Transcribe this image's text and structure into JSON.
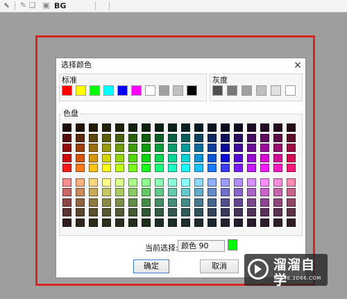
{
  "toolbar": {
    "text": "BG",
    "icons": [
      "arrow-icon",
      "brush-icon",
      "layers-icon",
      "bg-icon"
    ]
  },
  "dialog": {
    "title": "选择颜色",
    "close_symbol": "×",
    "standard": {
      "label": "标准",
      "colors": [
        "#ff0000",
        "#ffff00",
        "#00ff00",
        "#00ffff",
        "#0000ff",
        "#ff00ff",
        "#ffffff",
        "#a0a0a0",
        "#c0c0c0",
        "#000000"
      ]
    },
    "grayscale": {
      "label": "灰度",
      "colors": [
        "#505050",
        "#787878",
        "#a0a0a0",
        "#c0c0c0",
        "#e0e0e0",
        "#ffffff"
      ]
    },
    "palette": {
      "label": "色盘",
      "rows": [
        [
          "#1e0a0a",
          "#221208",
          "#221a08",
          "#22220a",
          "#1a220a",
          "#12220a",
          "#0a220a",
          "#0a2212",
          "#0a221a",
          "#0a2222",
          "#0a1a22",
          "#0a1222",
          "#0a0a22",
          "#120a22",
          "#1a0a22",
          "#220a22",
          "#220a1a",
          "#220a12",
          "#2a1414",
          "#200808",
          "#1a0a0e",
          "#140a12",
          "#100810",
          "#0c080c",
          "#1e1014",
          "#160a0e",
          "#120c14",
          "#0e0a12",
          "#0c0a10",
          "#0c0a0a",
          "#0c0a0a",
          "#0c0a0a",
          "#0c0a0a"
        ],
        [
          "#5a0e0e",
          "#5e2a0c",
          "#5e460c",
          "#5e5e0e",
          "#46600e",
          "#2a600e",
          "#0e600e",
          "#0e602a",
          "#0e6046",
          "#0e5e5e",
          "#0e465e",
          "#0e2a5e",
          "#0e0e5e",
          "#2a0e5e",
          "#460e5e",
          "#5e0e5e",
          "#5e0e46",
          "#5e0e2a"
        ],
        [
          "#960c0c",
          "#9a400a",
          "#9a6e0a",
          "#9a9a0c",
          "#6e9c0c",
          "#409c0c",
          "#0c9c0c",
          "#0c9c40",
          "#0c9c6e",
          "#0c9a9a",
          "#0c6e9a",
          "#0c409a",
          "#0c0c9a",
          "#400c9a",
          "#6e0c9a",
          "#9a0c9a",
          "#9a0c6e",
          "#9a0c40"
        ],
        [
          "#d00c0c",
          "#d4560a",
          "#d4960a",
          "#d4d40c",
          "#96d60c",
          "#56d60c",
          "#0cd60c",
          "#0cd656",
          "#0cd696",
          "#0cd4d4",
          "#0c96d4",
          "#0c56d4",
          "#0c0cd4",
          "#560cd4",
          "#960cd4",
          "#d40cd4",
          "#d40c96",
          "#d40c56"
        ],
        [
          "#ff1a1a",
          "#ff7a14",
          "#ffc414",
          "#ffff1a",
          "#c4ff1a",
          "#7aff1a",
          "#1aff1a",
          "#1aff7a",
          "#1affc4",
          "#1affff",
          "#1ac4ff",
          "#1a7aff",
          "#3a3aff",
          "#7a1aff",
          "#c41aff",
          "#ff1aff",
          "#ff1ac4",
          "#ff1a7a"
        ],
        [
          "#ff8c8c",
          "#ffb080",
          "#ffd880",
          "#ffff8c",
          "#d8ff8c",
          "#b0ff8c",
          "#8cff8c",
          "#8cffb0",
          "#8cffd8",
          "#8cffff",
          "#8cd8ff",
          "#8cb0ff",
          "#9c9cff",
          "#b08cff",
          "#d88cff",
          "#ff8cff",
          "#ff8cd8",
          "#ff8cb0"
        ],
        [
          "#c86464",
          "#c88a5a",
          "#c8aa5a",
          "#c8c864",
          "#aac864",
          "#8ac864",
          "#64c864",
          "#64c88a",
          "#64c8aa",
          "#64c8c8",
          "#64aac8",
          "#648ac8",
          "#7070c8",
          "#8a64c8",
          "#aa64c8",
          "#c864c8",
          "#c864aa",
          "#c8648a"
        ],
        [
          "#8c4646",
          "#8c6440",
          "#8c7a40",
          "#8c8c46",
          "#7a8c46",
          "#648c46",
          "#468c46",
          "#468c64",
          "#468c7a",
          "#468c8c",
          "#467a8c",
          "#46648c",
          "#50508c",
          "#64468c",
          "#7a468c",
          "#8c468c",
          "#8c467a",
          "#8c4664"
        ],
        [
          "#5a3232",
          "#5a442e",
          "#5a522e",
          "#5a5a32",
          "#525a32",
          "#445a32",
          "#325a32",
          "#325a44",
          "#325a52",
          "#325a5a",
          "#32525a",
          "#32445a",
          "#3a3a5a",
          "#44325a",
          "#52325a",
          "#5a325a",
          "#5a3252",
          "#5a3244"
        ],
        [
          "#2e1c1c",
          "#2e241a",
          "#2e2a1a",
          "#2e2e1c",
          "#2a2e1c",
          "#242e1c",
          "#1c2e1c",
          "#1c2e24",
          "#1c2e2a",
          "#1c2e2e",
          "#1c2a2e",
          "#1c242e",
          "#20202e",
          "#241c2e",
          "#2a1c2e",
          "#2e1c2e",
          "#2e1c2a",
          "#2e1c24"
        ]
      ]
    },
    "current": {
      "label": "当前选择:",
      "value": "颜色 90",
      "color": "#00ff00"
    },
    "ok_label": "确定",
    "cancel_label": "取消"
  },
  "watermark": {
    "title": "溜溜自学",
    "subtitle": "ZIXUE.3D66.COM"
  },
  "colors": {
    "highlight": "#d9251f",
    "background": "#9e9e9e"
  }
}
